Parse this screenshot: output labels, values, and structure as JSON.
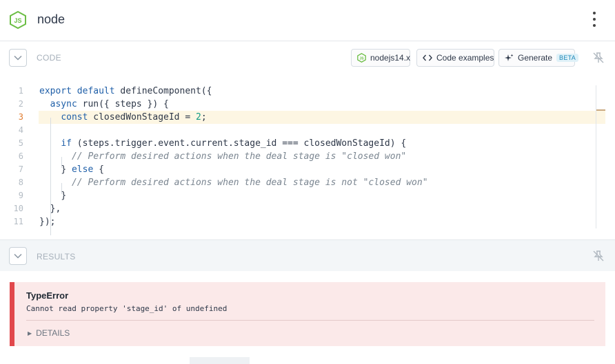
{
  "header": {
    "title": "node",
    "logo": "nodejs-icon",
    "menu_icon": "kebab-menu-icon"
  },
  "code_section": {
    "label": "CODE",
    "runtime_button": "nodejs14.x",
    "examples_button": "Code examples",
    "generate_button": "Generate",
    "beta_badge": "BETA",
    "active_line": 3,
    "line_numbers": [
      "1",
      "2",
      "3",
      "4",
      "5",
      "6",
      "7",
      "8",
      "9",
      "10",
      "11"
    ]
  },
  "code": {
    "l1_kw": "export default",
    "l1_rest": " defineComponent({",
    "l2_kw": "async",
    "l2_rest": " run({ steps }) {",
    "l3_kw": "const",
    "l3_a": " closedWonStageId = ",
    "l3_num": "2",
    "l3_b": ";",
    "l5_kw": "if",
    "l5_rest": " (steps.trigger.event.current.stage_id === closedWonStageId) {",
    "l6_cm": "// Perform desired actions when the deal stage is \"closed won\"",
    "l7_a": "} ",
    "l7_kw": "else",
    "l7_b": " {",
    "l8_cm": "// Perform desired actions when the deal stage is not \"closed won\"",
    "l9": "}",
    "l10": "},",
    "l11": "});"
  },
  "results_section": {
    "label": "RESULTS",
    "error": {
      "title": "TypeError",
      "message": "Cannot read property 'stage_id' of undefined",
      "details_label": "DETAILS"
    }
  },
  "colors": {
    "node_green": "#6cbe45",
    "error_red": "#e1484c",
    "active_line": "#fdf6e3"
  }
}
